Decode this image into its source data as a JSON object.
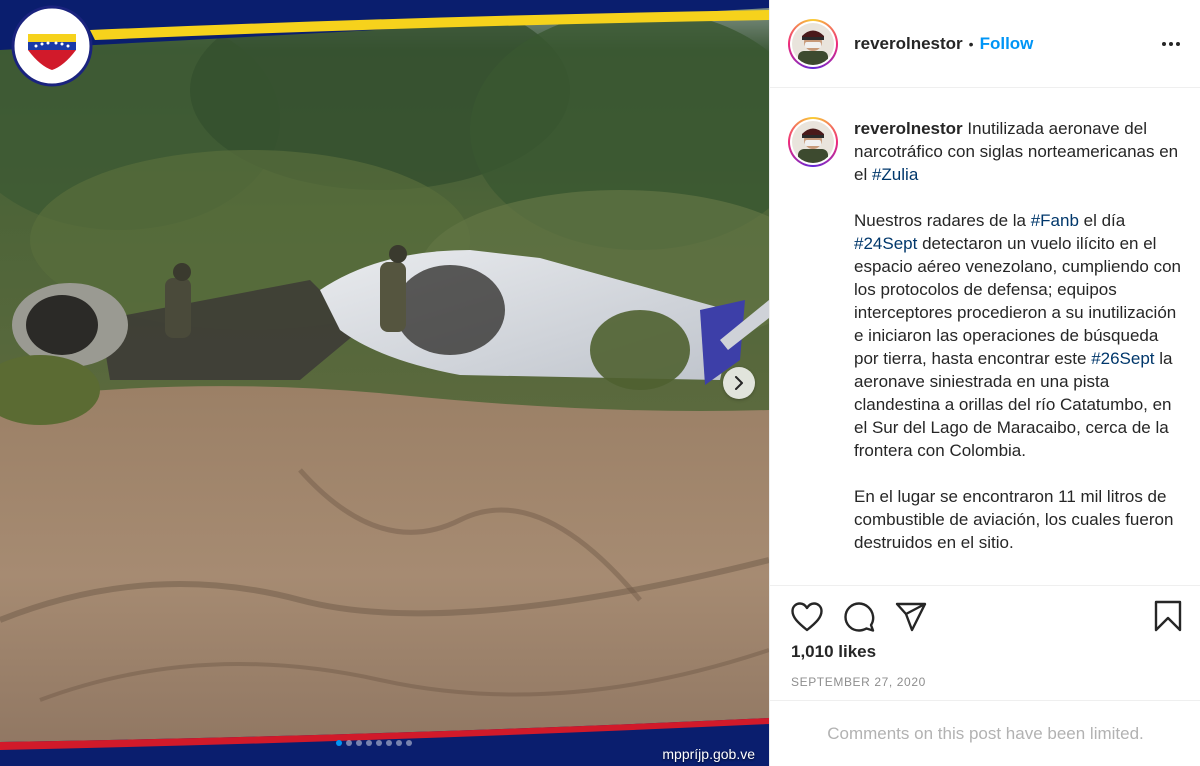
{
  "media": {
    "watermark": "mppríjp.gob.ve",
    "carousel": {
      "total": 8,
      "active_index": 0
    }
  },
  "header": {
    "username": "reverolnestor",
    "separator": "•",
    "follow_label": "Follow"
  },
  "caption": {
    "username": "reverolnestor",
    "p1": [
      {
        "text": "Inutilizada aeronave del narcotráfico con siglas norteamericanas en el ",
        "tag": false
      },
      {
        "text": "#Zulia",
        "tag": true
      }
    ],
    "p2": [
      {
        "text": "Nuestros radares de la ",
        "tag": false
      },
      {
        "text": "#Fanb",
        "tag": true
      },
      {
        "text": " el día ",
        "tag": false
      },
      {
        "text": "#24Sept",
        "tag": true
      },
      {
        "text": " detectaron un vuelo ilícito en el espacio aéreo venezolano, cumpliendo con los protocolos de defensa; equipos interceptores procedieron a su inutilización e iniciaron las operaciones de búsqueda por tierra, hasta encontrar este ",
        "tag": false
      },
      {
        "text": "#26Sept",
        "tag": true
      },
      {
        "text": " la aeronave siniestrada en una pista clandestina a orillas del río Catatumbo, en el Sur del Lago de Maracaibo, cerca de la frontera con Colombia.",
        "tag": false
      }
    ],
    "p3": [
      {
        "text": "En el lugar se encontraron 11 mil litros de combustible de aviación, los cuales fueron destruidos en el sitio.",
        "tag": false
      }
    ]
  },
  "engagement": {
    "likes": "1,010 likes",
    "date": "SEPTEMBER 27, 2020"
  },
  "comments": {
    "limited_message": "Comments on this post have been limited."
  },
  "colors": {
    "accent_blue": "#0095f6",
    "hashtag": "#00376b",
    "muted": "#8e8e8e"
  }
}
